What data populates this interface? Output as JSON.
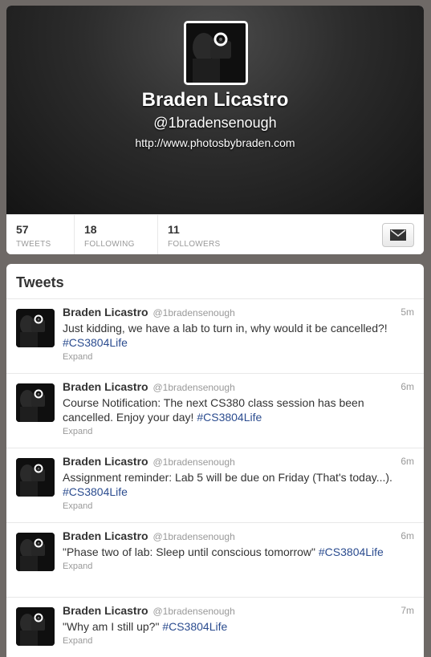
{
  "profile": {
    "name": "Braden Licastro",
    "handle": "@1bradensenough",
    "url": "http://www.photosbybraden.com"
  },
  "stats": [
    {
      "count": "57",
      "label": "TWEETS"
    },
    {
      "count": "18",
      "label": "FOLLOWING"
    },
    {
      "count": "11",
      "label": "FOLLOWERS"
    }
  ],
  "dm_button": {
    "icon": "envelope-icon"
  },
  "tweets_section": {
    "heading": "Tweets"
  },
  "tweets": [
    {
      "name": "Braden Licastro",
      "handle": "@1bradensenough",
      "time": "5m",
      "text": "Just kidding, we have a lab to turn in, why would it be cancelled?! ",
      "hashtag": "#CS3804Life",
      "expand": "Expand"
    },
    {
      "name": "Braden Licastro",
      "handle": "@1bradensenough",
      "time": "6m",
      "text": "Course Notification: The next CS380 class session has been cancelled. Enjoy your day! ",
      "hashtag": "#CS3804Life",
      "expand": "Expand"
    },
    {
      "name": "Braden Licastro",
      "handle": "@1bradensenough",
      "time": "6m",
      "text": "Assignment reminder: Lab 5 will be due on Friday (That's today...). ",
      "hashtag": "#CS3804Life",
      "expand": "Expand"
    },
    {
      "name": "Braden Licastro",
      "handle": "@1bradensenough",
      "time": "6m",
      "text": "\"Phase two of lab: Sleep until conscious tomorrow\" ",
      "hashtag": "#CS3804Life",
      "expand": "Expand"
    },
    {
      "name": "Braden Licastro",
      "handle": "@1bradensenough",
      "time": "7m",
      "text": "\"Why am I still up?\" ",
      "hashtag": "#CS3804Life",
      "expand": "Expand"
    }
  ],
  "colors": {
    "hashtag": "#2b4c8f",
    "header_bg": "#2c2c2c",
    "page_bg": "#6e6966"
  }
}
